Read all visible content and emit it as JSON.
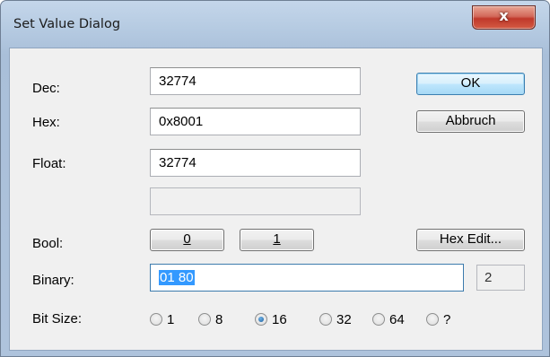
{
  "window": {
    "title": "Set Value Dialog",
    "close_glyph": "x"
  },
  "fields": {
    "dec": {
      "label": "Dec:",
      "value": "32774"
    },
    "hex": {
      "label": "Hex:",
      "value": "0x8001"
    },
    "float": {
      "label": "Float:",
      "value": "32774"
    },
    "extra": {
      "value": ""
    },
    "binary": {
      "label": "Binary:",
      "value": "01 80",
      "count": "2"
    }
  },
  "bool": {
    "label": "Bool:",
    "false_label": "0",
    "true_label": "1"
  },
  "buttons": {
    "ok": "OK",
    "cancel": "Abbruch",
    "hex_edit": "Hex Edit..."
  },
  "bit_size": {
    "label": "Bit Size:",
    "options": [
      {
        "label": "1",
        "checked": false
      },
      {
        "label": "8",
        "checked": false
      },
      {
        "label": "16",
        "checked": true
      },
      {
        "label": "32",
        "checked": false
      },
      {
        "label": "64",
        "checked": false
      },
      {
        "label": "?",
        "checked": false
      }
    ]
  }
}
